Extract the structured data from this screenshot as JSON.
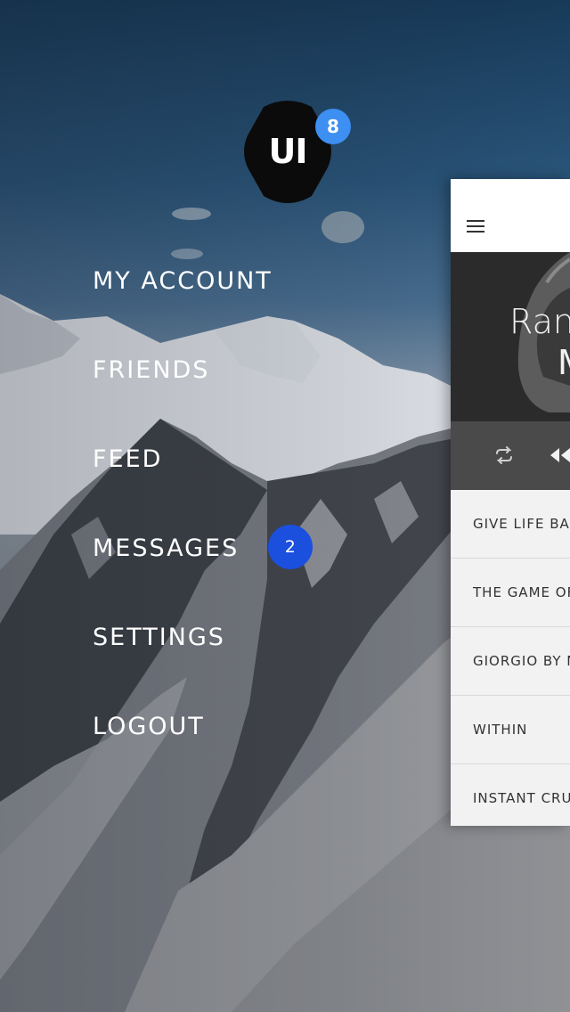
{
  "logo": {
    "text": "UI",
    "badge": "8"
  },
  "menu": {
    "items": [
      {
        "label": "MY ACCOUNT"
      },
      {
        "label": "FRIENDS"
      },
      {
        "label": "FEED"
      },
      {
        "label": "MESSAGES",
        "badge": "2"
      },
      {
        "label": "SETTINGS"
      },
      {
        "label": "LOGOUT"
      }
    ]
  },
  "panel": {
    "hero_line1": "Ran",
    "hero_line2": "M",
    "songs": [
      {
        "title": "GIVE LIFE BAC"
      },
      {
        "title": "THE GAME OF"
      },
      {
        "title": "GIORGIO BY M"
      },
      {
        "title": "WITHIN"
      },
      {
        "title": "INSTANT CRU"
      }
    ]
  },
  "colors": {
    "badge_blue": "#3d8ff1",
    "messages_badge": "#1b4fdd",
    "panel_bg": "#f2f2f2",
    "hero_bg": "#2b2b2b",
    "controls_bg": "#4a4a4a"
  },
  "icons": [
    "hamburger-icon",
    "repeat-icon",
    "rewind-icon"
  ]
}
